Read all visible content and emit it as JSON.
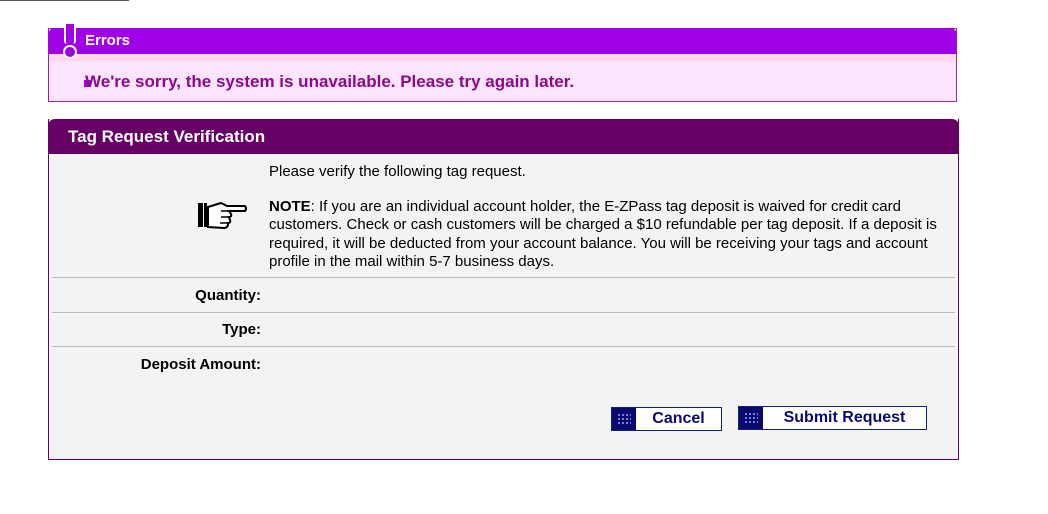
{
  "errors": {
    "title": "Errors",
    "message": "We're sorry, the system is unavailable. Please try again later."
  },
  "verification": {
    "title": "Tag Request Verification",
    "intro": "Please verify the following tag request.",
    "note_label": "NOTE",
    "note_text": ": If you are an individual account holder, the E-ZPass tag deposit is waived for credit card customers. Check or cash customers will be charged a $10 refundable per tag deposit. If a deposit is required, it will be deducted from your account balance. You will be receiving your tags and account profile in the mail within 5-7 business days.",
    "fields": {
      "quantity_label": "Quantity:",
      "type_label": "Type:",
      "deposit_label": "Deposit Amount:"
    }
  },
  "buttons": {
    "cancel": "Cancel",
    "submit": "Submit Request"
  }
}
